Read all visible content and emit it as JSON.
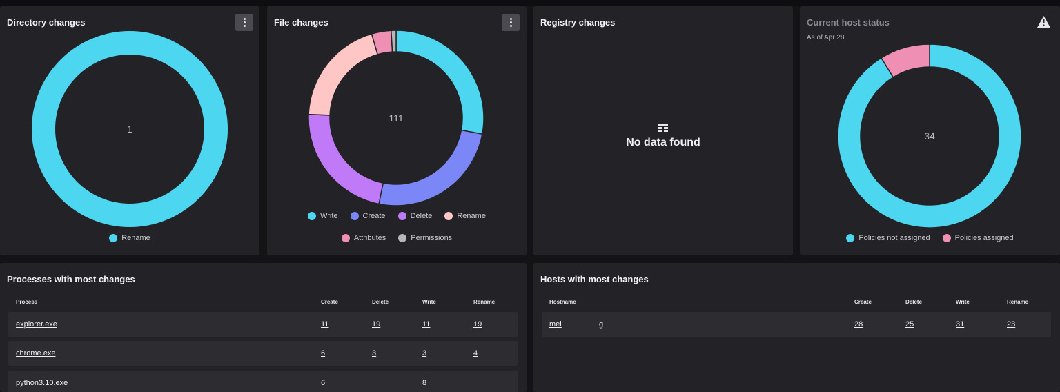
{
  "directory_changes": {
    "title": "Directory changes",
    "total": "1",
    "legend": [
      {
        "label": "Rename",
        "color": "#4dd6f0"
      }
    ],
    "chart_data": {
      "type": "pie",
      "categories": [
        "Rename"
      ],
      "values": [
        1
      ]
    }
  },
  "file_changes": {
    "title": "File changes",
    "total": "111",
    "legend": [
      {
        "label": "Write",
        "color": "#4dd6f0"
      },
      {
        "label": "Create",
        "color": "#7b86f7"
      },
      {
        "label": "Delete",
        "color": "#c17af7"
      },
      {
        "label": "Rename",
        "color": "#ffc6c6"
      },
      {
        "label": "Attributes",
        "color": "#ef8fb4"
      },
      {
        "label": "Permissions",
        "color": "#b7b7b7"
      }
    ],
    "chart_data": {
      "type": "pie",
      "categories": [
        "Write",
        "Create",
        "Delete",
        "Rename",
        "Attributes",
        "Permissions"
      ],
      "values": [
        31,
        28,
        25,
        22,
        4,
        1
      ]
    }
  },
  "registry_changes": {
    "title": "Registry changes",
    "empty_text": "No data found"
  },
  "host_status": {
    "title": "Current host status",
    "subtitle": "As of Apr 28",
    "total": "34",
    "legend": [
      {
        "label": "Policies not assigned",
        "color": "#4dd6f0"
      },
      {
        "label": "Policies assigned",
        "color": "#ef8fb4"
      }
    ],
    "chart_data": {
      "type": "pie",
      "categories": [
        "Policies not assigned",
        "Policies assigned"
      ],
      "values": [
        31,
        3
      ]
    }
  },
  "processes": {
    "title": "Processes with most changes",
    "columns": [
      "Process",
      "Create",
      "Delete",
      "Write",
      "Rename"
    ],
    "rows": [
      {
        "name": "explorer.exe",
        "create": "11",
        "delete": "19",
        "write": "11",
        "rename": "19"
      },
      {
        "name": "chrome.exe",
        "create": "6",
        "delete": "3",
        "write": "3",
        "rename": "4"
      },
      {
        "name": "python3.10.exe",
        "create": "6",
        "delete": "",
        "write": "8",
        "rename": ""
      }
    ]
  },
  "hosts": {
    "title": "Hosts with most changes",
    "columns": [
      "Hostname",
      "Create",
      "Delete",
      "Write",
      "Rename"
    ],
    "rows": [
      {
        "name": "mel",
        "name_tail": "ıg",
        "create": "28",
        "delete": "25",
        "write": "31",
        "rename": "23"
      }
    ]
  }
}
